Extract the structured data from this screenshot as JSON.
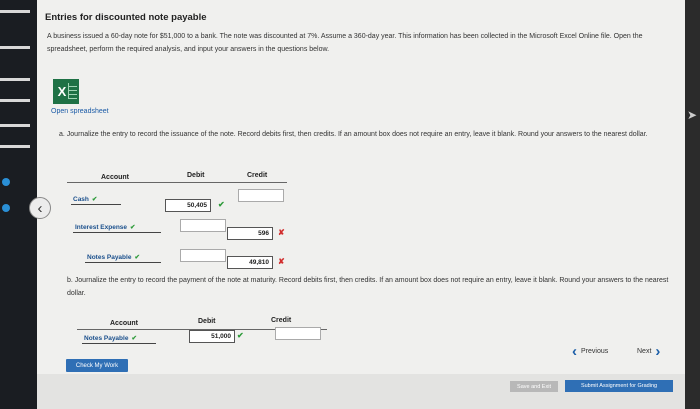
{
  "title": "Entries for discounted note payable",
  "description": "A business issued a 60-day note for $51,000 to a bank. The note was discounted at 7%. Assume a 360-day year. This information has been collected in the Microsoft Excel Online file. Open the spreadsheet, perform the required analysis, and input your answers in the questions below.",
  "open_spreadsheet": "Open spreadsheet",
  "excel_icon_letter": "X",
  "part_a": {
    "question": "a. Journalize the entry to record the issuance of the note. Record debits first, then credits. If an amount box does not require an entry, leave it blank. Round your answers to the nearest dollar.",
    "headers": {
      "account": "Account",
      "debit": "Debit",
      "credit": "Credit"
    },
    "rows": [
      {
        "account": "Cash",
        "account_status": "correct",
        "debit": "50,405",
        "debit_status": "correct",
        "credit": "",
        "credit_status": ""
      },
      {
        "account": "Interest Expense",
        "account_status": "correct",
        "debit": "",
        "debit_status": "",
        "credit": "596",
        "credit_status": "incorrect"
      },
      {
        "account": "Notes Payable",
        "account_status": "correct",
        "debit": "",
        "debit_status": "",
        "credit": "49,810",
        "credit_status": "incorrect"
      }
    ]
  },
  "part_b": {
    "question": "b. Journalize the entry to record the payment of the note at maturity. Record debits first, then credits. If an amount box does not require an entry, leave it blank. Round your answers to the nearest dollar.",
    "headers": {
      "account": "Account",
      "debit": "Debit",
      "credit": "Credit"
    },
    "rows": [
      {
        "account": "Notes Payable",
        "account_status": "correct",
        "debit": "51,000",
        "debit_status": "correct",
        "credit": "",
        "credit_status": ""
      }
    ]
  },
  "marks": {
    "correct": "✔",
    "incorrect": "✘"
  },
  "buttons": {
    "check_my_work": "Check My Work",
    "previous": "Previous",
    "next": "Next",
    "save_exit": "Save and Exit",
    "submit": "Submit Assignment for Grading"
  },
  "colors": {
    "accent": "#2f6fb5",
    "correct": "#2e9b3a",
    "incorrect": "#d12c2c",
    "excel": "#1e7145"
  }
}
